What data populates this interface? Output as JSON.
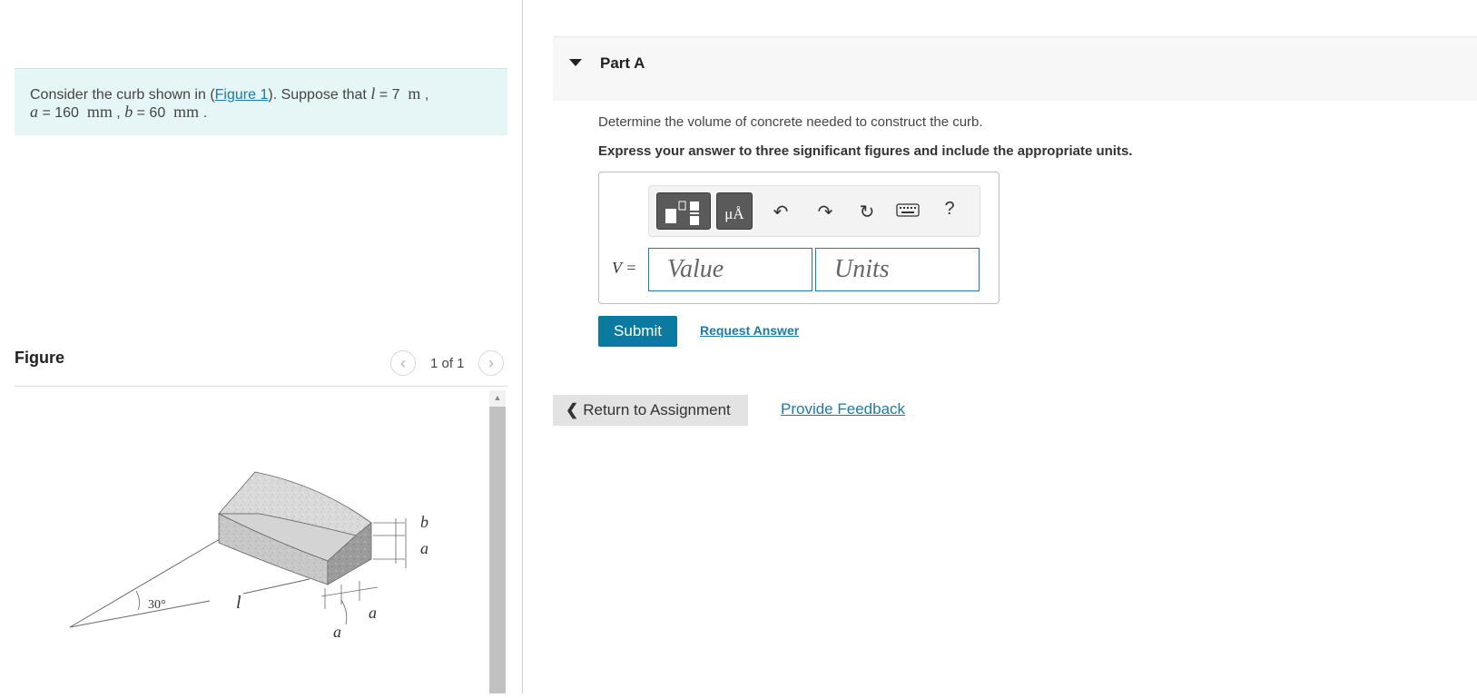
{
  "problem": {
    "prefix": "Consider the curb shown in (",
    "figure_link": "Figure 1",
    "mid": "). Suppose that ",
    "l_symbol": "l",
    "l_value": " = 7",
    "l_unit": "m",
    "sep1": " ,",
    "a_symbol": "a",
    "a_value": " = 160",
    "a_unit": "mm",
    "sep2": " , ",
    "b_symbol": "b",
    "b_value": " = 60",
    "b_unit": "mm",
    "end": " ."
  },
  "figure": {
    "title": "Figure",
    "counter": "1 of 1",
    "labels": {
      "b": "b",
      "a_right": "a",
      "a_bottom1": "a",
      "a_bottom2": "a",
      "l": "l",
      "angle": "30°"
    }
  },
  "part": {
    "title": "Part A"
  },
  "question": "Determine the volume of concrete needed to construct the curb.",
  "instruction": "Express your answer to three significant figures and include the appropriate units.",
  "answer": {
    "variable": "V =",
    "value_placeholder": "Value",
    "units_placeholder": "Units",
    "units_tool_label": "μÅ",
    "help_label": "?"
  },
  "actions": {
    "submit": "Submit",
    "request_answer": "Request Answer",
    "return": "Return to Assignment",
    "feedback": "Provide Feedback"
  },
  "colors": {
    "accent": "#0b7aa1",
    "problem_bg": "#e6f5f5",
    "input_border": "#1e7fa3"
  }
}
